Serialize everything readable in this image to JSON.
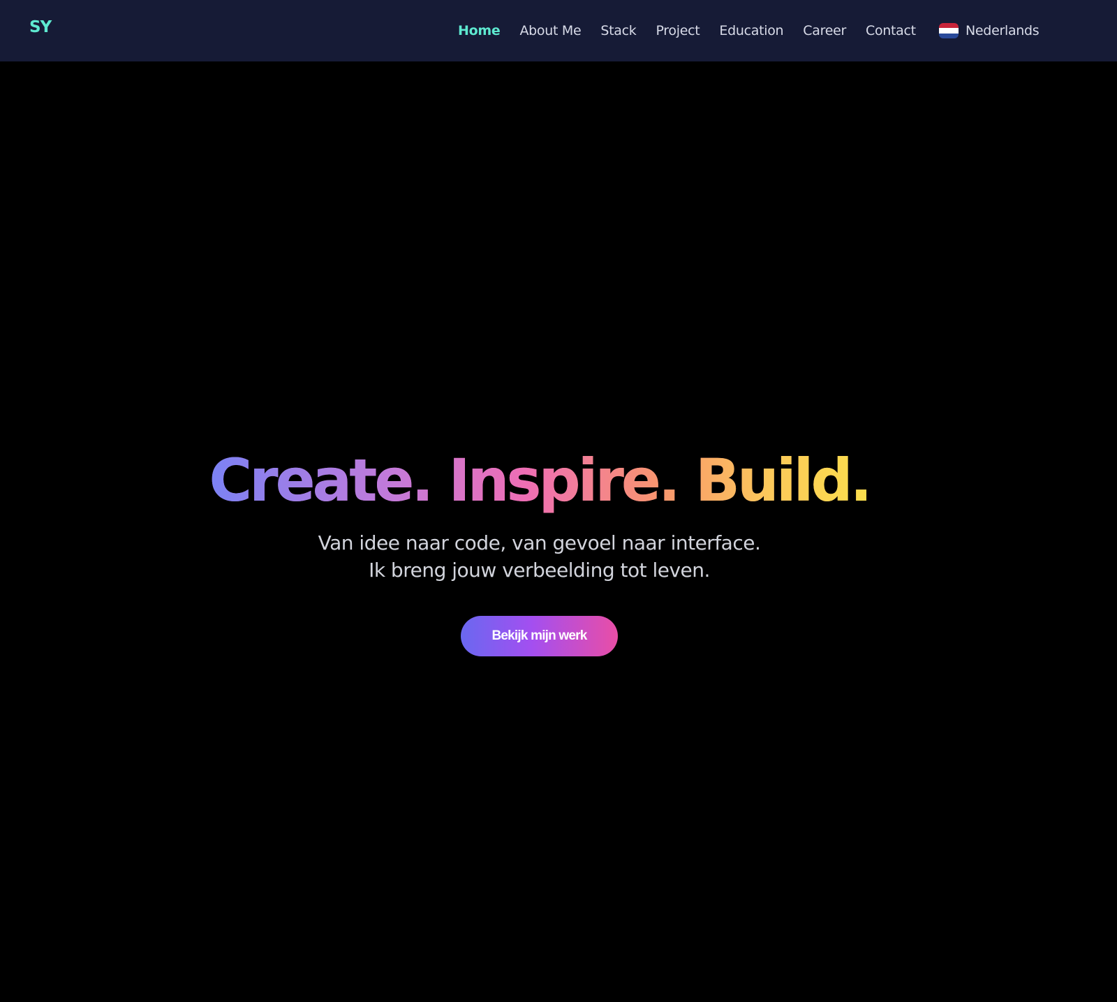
{
  "navbar": {
    "logo": "SY",
    "links": [
      {
        "label": "Home",
        "active": true
      },
      {
        "label": "About Me"
      },
      {
        "label": "Stack"
      },
      {
        "label": "Project"
      },
      {
        "label": "Education"
      },
      {
        "label": "Career"
      },
      {
        "label": "Contact"
      }
    ],
    "language": {
      "flag_icon": "netherlands-flag-icon",
      "label": "Nederlands"
    }
  },
  "hero": {
    "headline": "Create. Inspire. Build.",
    "subtitle_line1": "Van idee naar code, van gevoel naar interface.",
    "subtitle_line2": "Ik breng jouw verbeelding tot leven.",
    "cta_label": "Bekijk mijn werk"
  },
  "colors": {
    "nav_background": "#161b36",
    "accent": "#5ee9d0",
    "page_background": "#000000",
    "headline_gradient": [
      "#7b82f4",
      "#ee6eb4",
      "#fbdf4c"
    ],
    "cta_gradient": [
      "#6a68f0",
      "#a34ff0",
      "#e94ea6"
    ]
  }
}
